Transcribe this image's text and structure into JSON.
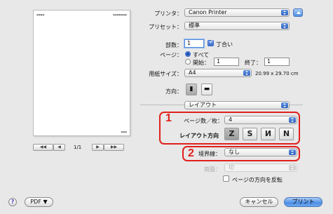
{
  "preview": {
    "page_indicator": "1/1",
    "nav_first": "◀◀",
    "nav_prev": "◀",
    "nav_next": "▶",
    "nav_last": "▶▶"
  },
  "printer": {
    "label": "プリンタ：",
    "value": "Canon Printer"
  },
  "presets": {
    "label": "プリセット：",
    "value": "標準"
  },
  "copies": {
    "label": "部数：",
    "value": "1",
    "collate_label": "丁合い"
  },
  "pages": {
    "label": "ページ：",
    "all_label": "すべて",
    "from_label": "開始：",
    "from_value": "1",
    "to_label": "終了：",
    "to_value": "1"
  },
  "paper_size": {
    "label": "用紙サイズ：",
    "value": "A4",
    "dimensions": "20.99 x 29.70 cm"
  },
  "orientation": {
    "label": "方向："
  },
  "panel": {
    "value": "レイアウト"
  },
  "layout": {
    "pages_per_sheet_label": "ページ数／枚：",
    "pages_per_sheet_value": "4",
    "direction_label": "レイアウト方向"
  },
  "border": {
    "label": "境界線：",
    "value": "なし"
  },
  "two_sided": {
    "label": "両面：",
    "value": "切"
  },
  "reverse": {
    "label": "ページの方向を反転"
  },
  "footer": {
    "help": "?",
    "pdf_label": "PDF ▼",
    "cancel_label": "キャンセル",
    "print_label": "プリント"
  },
  "annotations": {
    "marker1": "1",
    "marker2": "2"
  },
  "colors": {
    "annotation": "#e0201c",
    "accent": "#4d8fe6"
  }
}
